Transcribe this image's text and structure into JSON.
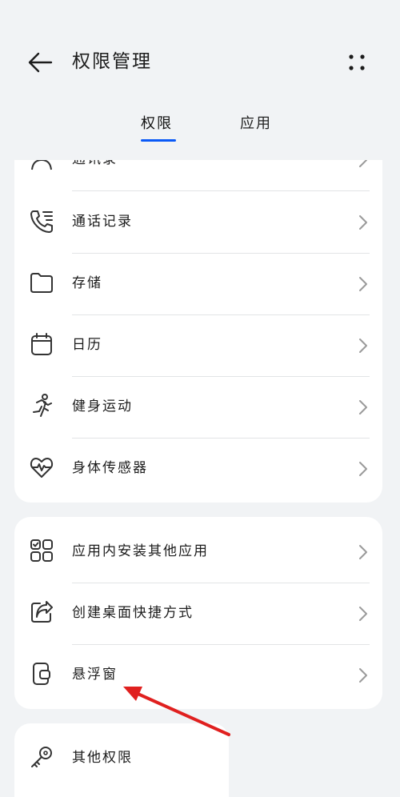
{
  "header": {
    "title": "权限管理"
  },
  "tabs": [
    {
      "label": "权限",
      "active": true
    },
    {
      "label": "应用",
      "active": false
    }
  ],
  "groups": [
    {
      "items": [
        {
          "label": "通讯录",
          "icon": "contacts-icon"
        },
        {
          "label": "通话记录",
          "icon": "call-log-icon"
        },
        {
          "label": "存储",
          "icon": "folder-icon"
        },
        {
          "label": "日历",
          "icon": "calendar-icon"
        },
        {
          "label": "健身运动",
          "icon": "running-icon"
        },
        {
          "label": "身体传感器",
          "icon": "heart-rate-icon"
        }
      ]
    },
    {
      "items": [
        {
          "label": "应用内安装其他应用",
          "icon": "app-install-icon"
        },
        {
          "label": "创建桌面快捷方式",
          "icon": "shortcut-icon"
        },
        {
          "label": "悬浮窗",
          "icon": "floating-window-icon"
        }
      ]
    },
    {
      "items": [
        {
          "label": "其他权限",
          "icon": "key-icon"
        }
      ]
    }
  ],
  "colors": {
    "accent": "#0a59f7",
    "annotation_arrow": "#e0201f",
    "background": "#f1f3f5",
    "card": "#ffffff"
  }
}
